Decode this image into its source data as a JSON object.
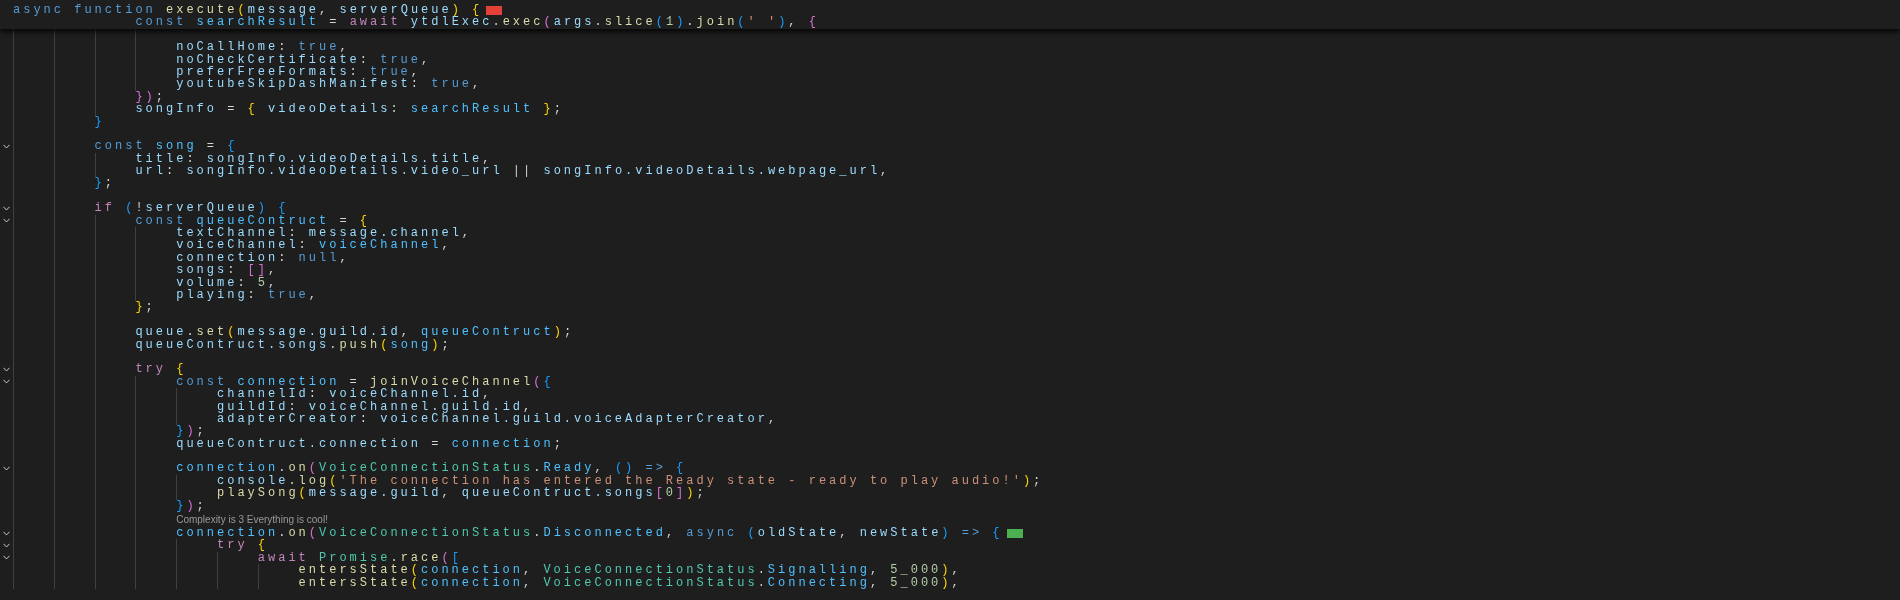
{
  "sticky": [
    {
      "color": "#e5403a",
      "tokens": [
        {
          "kind": "keyword",
          "text": "async function "
        },
        {
          "kind": "function",
          "text": "execute"
        },
        {
          "kind": "bracket1",
          "text": "("
        },
        {
          "kind": "variable",
          "text": "message"
        },
        {
          "kind": "plain",
          "text": ", "
        },
        {
          "kind": "variable",
          "text": "serverQueue"
        },
        {
          "kind": "bracket1",
          "text": ") "
        },
        {
          "kind": "bracket1",
          "text": "{"
        }
      ]
    },
    {
      "tokens": [
        {
          "kind": "keyword",
          "text": "            const "
        },
        {
          "kind": "constant",
          "text": "searchResult"
        },
        {
          "kind": "plain",
          "text": " = "
        },
        {
          "kind": "control",
          "text": "await "
        },
        {
          "kind": "variable",
          "text": "ytdlExec"
        },
        {
          "kind": "plain",
          "text": "."
        },
        {
          "kind": "function",
          "text": "exec"
        },
        {
          "kind": "bracket2",
          "text": "("
        },
        {
          "kind": "variable",
          "text": "args"
        },
        {
          "kind": "plain",
          "text": "."
        },
        {
          "kind": "function",
          "text": "slice"
        },
        {
          "kind": "bracket3",
          "text": "("
        },
        {
          "kind": "number",
          "text": "1"
        },
        {
          "kind": "bracket3",
          "text": ")"
        },
        {
          "kind": "plain",
          "text": "."
        },
        {
          "kind": "function",
          "text": "join"
        },
        {
          "kind": "bracket3",
          "text": "("
        },
        {
          "kind": "string",
          "text": "' '"
        },
        {
          "kind": "bracket3",
          "text": ")"
        },
        {
          "kind": "plain",
          "text": ", "
        },
        {
          "kind": "bracket2",
          "text": "{"
        }
      ]
    }
  ],
  "lines": [
    {
      "kind": "blank",
      "fold": false
    },
    {
      "kind": "code",
      "fold": false,
      "tokens": [
        {
          "kind": "variable",
          "text": "                noCallHome"
        },
        {
          "kind": "plain",
          "text": ": "
        },
        {
          "kind": "keyword",
          "text": "true"
        },
        {
          "kind": "plain",
          "text": ","
        }
      ]
    },
    {
      "kind": "code",
      "fold": false,
      "tokens": [
        {
          "kind": "variable",
          "text": "                noCheckCertificate"
        },
        {
          "kind": "plain",
          "text": ": "
        },
        {
          "kind": "keyword",
          "text": "true"
        },
        {
          "kind": "plain",
          "text": ","
        }
      ]
    },
    {
      "kind": "code",
      "fold": false,
      "tokens": [
        {
          "kind": "variable",
          "text": "                preferFreeFormats"
        },
        {
          "kind": "plain",
          "text": ": "
        },
        {
          "kind": "keyword",
          "text": "true"
        },
        {
          "kind": "plain",
          "text": ","
        }
      ]
    },
    {
      "kind": "code",
      "fold": false,
      "tokens": [
        {
          "kind": "variable",
          "text": "                youtubeSkipDashManifest"
        },
        {
          "kind": "plain",
          "text": ": "
        },
        {
          "kind": "keyword",
          "text": "true"
        },
        {
          "kind": "plain",
          "text": ","
        }
      ]
    },
    {
      "kind": "code",
      "fold": false,
      "tokens": [
        {
          "kind": "bracket2",
          "text": "            })"
        },
        {
          "kind": "plain",
          "text": ";"
        }
      ]
    },
    {
      "kind": "code",
      "fold": false,
      "tokens": [
        {
          "kind": "variable",
          "text": "            songInfo"
        },
        {
          "kind": "plain",
          "text": " = "
        },
        {
          "kind": "bracket1",
          "text": "{ "
        },
        {
          "kind": "variable",
          "text": "videoDetails"
        },
        {
          "kind": "plain",
          "text": ": "
        },
        {
          "kind": "constant",
          "text": "searchResult "
        },
        {
          "kind": "bracket1",
          "text": "}"
        },
        {
          "kind": "plain",
          "text": ";"
        }
      ]
    },
    {
      "kind": "code",
      "fold": false,
      "tokens": [
        {
          "kind": "bracket3",
          "text": "        }"
        }
      ]
    },
    {
      "kind": "blank",
      "fold": false
    },
    {
      "kind": "code",
      "fold": true,
      "tokens": [
        {
          "kind": "keyword",
          "text": "        const "
        },
        {
          "kind": "constant",
          "text": "song"
        },
        {
          "kind": "plain",
          "text": " = "
        },
        {
          "kind": "bracket3",
          "text": "{"
        }
      ]
    },
    {
      "kind": "code",
      "fold": false,
      "tokens": [
        {
          "kind": "variable",
          "text": "            title"
        },
        {
          "kind": "plain",
          "text": ": "
        },
        {
          "kind": "variable",
          "text": "songInfo.videoDetails.title"
        },
        {
          "kind": "plain",
          "text": ","
        }
      ]
    },
    {
      "kind": "code",
      "fold": false,
      "tokens": [
        {
          "kind": "variable",
          "text": "            url"
        },
        {
          "kind": "plain",
          "text": ": "
        },
        {
          "kind": "variable",
          "text": "songInfo.videoDetails.video_url"
        },
        {
          "kind": "plain",
          "text": " || "
        },
        {
          "kind": "variable",
          "text": "songInfo.videoDetails.webpage_url"
        },
        {
          "kind": "plain",
          "text": ","
        }
      ]
    },
    {
      "kind": "code",
      "fold": false,
      "tokens": [
        {
          "kind": "bracket3",
          "text": "        }"
        },
        {
          "kind": "plain",
          "text": ";"
        }
      ]
    },
    {
      "kind": "blank",
      "fold": false
    },
    {
      "kind": "code",
      "fold": true,
      "tokens": [
        {
          "kind": "control",
          "text": "        if "
        },
        {
          "kind": "bracket3",
          "text": "("
        },
        {
          "kind": "plain",
          "text": "!"
        },
        {
          "kind": "variable",
          "text": "serverQueue"
        },
        {
          "kind": "bracket3",
          "text": ") "
        },
        {
          "kind": "bracket3",
          "text": "{"
        }
      ]
    },
    {
      "kind": "code",
      "fold": true,
      "tokens": [
        {
          "kind": "keyword",
          "text": "            const "
        },
        {
          "kind": "constant",
          "text": "queueContruct"
        },
        {
          "kind": "plain",
          "text": " = "
        },
        {
          "kind": "bracket1",
          "text": "{"
        }
      ]
    },
    {
      "kind": "code",
      "fold": false,
      "tokens": [
        {
          "kind": "variable",
          "text": "                textChannel"
        },
        {
          "kind": "plain",
          "text": ": "
        },
        {
          "kind": "variable",
          "text": "message.channel"
        },
        {
          "kind": "plain",
          "text": ","
        }
      ]
    },
    {
      "kind": "code",
      "fold": false,
      "tokens": [
        {
          "kind": "variable",
          "text": "                voiceChannel"
        },
        {
          "kind": "plain",
          "text": ": "
        },
        {
          "kind": "constant",
          "text": "voiceChannel"
        },
        {
          "kind": "plain",
          "text": ","
        }
      ]
    },
    {
      "kind": "code",
      "fold": false,
      "tokens": [
        {
          "kind": "variable",
          "text": "                connection"
        },
        {
          "kind": "plain",
          "text": ": "
        },
        {
          "kind": "keyword",
          "text": "null"
        },
        {
          "kind": "plain",
          "text": ","
        }
      ]
    },
    {
      "kind": "code",
      "fold": false,
      "tokens": [
        {
          "kind": "variable",
          "text": "                songs"
        },
        {
          "kind": "plain",
          "text": ": "
        },
        {
          "kind": "bracket2",
          "text": "[]"
        },
        {
          "kind": "plain",
          "text": ","
        }
      ]
    },
    {
      "kind": "code",
      "fold": false,
      "tokens": [
        {
          "kind": "variable",
          "text": "                volume"
        },
        {
          "kind": "plain",
          "text": ": "
        },
        {
          "kind": "number",
          "text": "5"
        },
        {
          "kind": "plain",
          "text": ","
        }
      ]
    },
    {
      "kind": "code",
      "fold": false,
      "tokens": [
        {
          "kind": "variable",
          "text": "                playing"
        },
        {
          "kind": "plain",
          "text": ": "
        },
        {
          "kind": "keyword",
          "text": "true"
        },
        {
          "kind": "plain",
          "text": ","
        }
      ]
    },
    {
      "kind": "code",
      "fold": false,
      "tokens": [
        {
          "kind": "bracket1",
          "text": "            }"
        },
        {
          "kind": "plain",
          "text": ";"
        }
      ]
    },
    {
      "kind": "blank",
      "fold": false
    },
    {
      "kind": "code",
      "fold": false,
      "tokens": [
        {
          "kind": "variable",
          "text": "            queue"
        },
        {
          "kind": "plain",
          "text": "."
        },
        {
          "kind": "function",
          "text": "set"
        },
        {
          "kind": "bracket1",
          "text": "("
        },
        {
          "kind": "variable",
          "text": "message.guild.id"
        },
        {
          "kind": "plain",
          "text": ", "
        },
        {
          "kind": "constant",
          "text": "queueContruct"
        },
        {
          "kind": "bracket1",
          "text": ")"
        },
        {
          "kind": "plain",
          "text": ";"
        }
      ]
    },
    {
      "kind": "code",
      "fold": false,
      "tokens": [
        {
          "kind": "variable",
          "text": "            queueContruct.songs"
        },
        {
          "kind": "plain",
          "text": "."
        },
        {
          "kind": "function",
          "text": "push"
        },
        {
          "kind": "bracket1",
          "text": "("
        },
        {
          "kind": "constant",
          "text": "song"
        },
        {
          "kind": "bracket1",
          "text": ")"
        },
        {
          "kind": "plain",
          "text": ";"
        }
      ]
    },
    {
      "kind": "blank",
      "fold": false
    },
    {
      "kind": "code",
      "fold": true,
      "tokens": [
        {
          "kind": "control",
          "text": "            try "
        },
        {
          "kind": "bracket1",
          "text": "{"
        }
      ]
    },
    {
      "kind": "code",
      "fold": true,
      "tokens": [
        {
          "kind": "keyword",
          "text": "                const "
        },
        {
          "kind": "constant",
          "text": "connection"
        },
        {
          "kind": "plain",
          "text": " = "
        },
        {
          "kind": "function",
          "text": "joinVoiceChannel"
        },
        {
          "kind": "bracket2",
          "text": "("
        },
        {
          "kind": "bracket3",
          "text": "{"
        }
      ]
    },
    {
      "kind": "code",
      "fold": false,
      "tokens": [
        {
          "kind": "variable",
          "text": "                    channelId"
        },
        {
          "kind": "plain",
          "text": ": "
        },
        {
          "kind": "variable",
          "text": "voiceChannel.id"
        },
        {
          "kind": "plain",
          "text": ","
        }
      ]
    },
    {
      "kind": "code",
      "fold": false,
      "tokens": [
        {
          "kind": "variable",
          "text": "                    guildId"
        },
        {
          "kind": "plain",
          "text": ": "
        },
        {
          "kind": "variable",
          "text": "voiceChannel.guild.id"
        },
        {
          "kind": "plain",
          "text": ","
        }
      ]
    },
    {
      "kind": "code",
      "fold": false,
      "tokens": [
        {
          "kind": "variable",
          "text": "                    adapterCreator"
        },
        {
          "kind": "plain",
          "text": ": "
        },
        {
          "kind": "variable",
          "text": "voiceChannel.guild.voiceAdapterCreator"
        },
        {
          "kind": "plain",
          "text": ","
        }
      ]
    },
    {
      "kind": "code",
      "fold": false,
      "tokens": [
        {
          "kind": "bracket3",
          "text": "                }"
        },
        {
          "kind": "bracket2",
          "text": ")"
        },
        {
          "kind": "plain",
          "text": ";"
        }
      ]
    },
    {
      "kind": "code",
      "fold": false,
      "tokens": [
        {
          "kind": "variable",
          "text": "                queueContruct.connection"
        },
        {
          "kind": "plain",
          "text": " = "
        },
        {
          "kind": "constant",
          "text": "connection"
        },
        {
          "kind": "plain",
          "text": ";"
        }
      ]
    },
    {
      "kind": "blank",
      "fold": false
    },
    {
      "kind": "code",
      "fold": true,
      "tokens": [
        {
          "kind": "constant",
          "text": "                connection"
        },
        {
          "kind": "plain",
          "text": "."
        },
        {
          "kind": "function",
          "text": "on"
        },
        {
          "kind": "bracket2",
          "text": "("
        },
        {
          "kind": "type",
          "text": "VoiceConnectionStatus"
        },
        {
          "kind": "plain",
          "text": "."
        },
        {
          "kind": "constant",
          "text": "Ready"
        },
        {
          "kind": "plain",
          "text": ", "
        },
        {
          "kind": "bracket3",
          "text": "() "
        },
        {
          "kind": "keyword",
          "text": "=> "
        },
        {
          "kind": "bracket3",
          "text": "{"
        }
      ]
    },
    {
      "kind": "code",
      "fold": false,
      "tokens": [
        {
          "kind": "variable",
          "text": "                    console"
        },
        {
          "kind": "plain",
          "text": "."
        },
        {
          "kind": "function",
          "text": "log"
        },
        {
          "kind": "bracket1",
          "text": "("
        },
        {
          "kind": "string",
          "text": "'The connection has entered the Ready state - ready to play audio!'"
        },
        {
          "kind": "bracket1",
          "text": ")"
        },
        {
          "kind": "plain",
          "text": ";"
        }
      ]
    },
    {
      "kind": "code",
      "fold": false,
      "tokens": [
        {
          "kind": "function",
          "text": "                    playSong"
        },
        {
          "kind": "bracket1",
          "text": "("
        },
        {
          "kind": "variable",
          "text": "message.guild"
        },
        {
          "kind": "plain",
          "text": ", "
        },
        {
          "kind": "variable",
          "text": "queueContruct.songs"
        },
        {
          "kind": "bracket2",
          "text": "["
        },
        {
          "kind": "number",
          "text": "0"
        },
        {
          "kind": "bracket2",
          "text": "]"
        },
        {
          "kind": "bracket1",
          "text": ")"
        },
        {
          "kind": "plain",
          "text": ";"
        }
      ]
    },
    {
      "kind": "code",
      "fold": false,
      "tokens": [
        {
          "kind": "bracket3",
          "text": "                }"
        },
        {
          "kind": "bracket2",
          "text": ")"
        },
        {
          "kind": "plain",
          "text": ";"
        }
      ]
    },
    {
      "kind": "codelens",
      "fold": false,
      "text": "Complexity is 3 Everything is cool!"
    },
    {
      "kind": "code",
      "fold": true,
      "color": "#4caf50",
      "tokens": [
        {
          "kind": "constant",
          "text": "                connection"
        },
        {
          "kind": "plain",
          "text": "."
        },
        {
          "kind": "function",
          "text": "on"
        },
        {
          "kind": "bracket2",
          "text": "("
        },
        {
          "kind": "type",
          "text": "VoiceConnectionStatus"
        },
        {
          "kind": "plain",
          "text": "."
        },
        {
          "kind": "constant",
          "text": "Disconnected"
        },
        {
          "kind": "plain",
          "text": ", "
        },
        {
          "kind": "keyword",
          "text": "async "
        },
        {
          "kind": "bracket3",
          "text": "("
        },
        {
          "kind": "variable",
          "text": "oldState"
        },
        {
          "kind": "plain",
          "text": ", "
        },
        {
          "kind": "variable",
          "text": "newState"
        },
        {
          "kind": "bracket3",
          "text": ") "
        },
        {
          "kind": "keyword",
          "text": "=> "
        },
        {
          "kind": "bracket3",
          "text": "{"
        }
      ]
    },
    {
      "kind": "code",
      "fold": true,
      "tokens": [
        {
          "kind": "control",
          "text": "                    try "
        },
        {
          "kind": "bracket1",
          "text": "{"
        }
      ]
    },
    {
      "kind": "code",
      "fold": true,
      "tokens": [
        {
          "kind": "control",
          "text": "                        await "
        },
        {
          "kind": "type",
          "text": "Promise"
        },
        {
          "kind": "plain",
          "text": "."
        },
        {
          "kind": "function",
          "text": "race"
        },
        {
          "kind": "bracket2",
          "text": "("
        },
        {
          "kind": "bracket3",
          "text": "["
        }
      ]
    },
    {
      "kind": "code",
      "fold": false,
      "tokens": [
        {
          "kind": "function",
          "text": "                            entersState"
        },
        {
          "kind": "bracket1",
          "text": "("
        },
        {
          "kind": "constant",
          "text": "connection"
        },
        {
          "kind": "plain",
          "text": ", "
        },
        {
          "kind": "type",
          "text": "VoiceConnectionStatus"
        },
        {
          "kind": "plain",
          "text": "."
        },
        {
          "kind": "constant",
          "text": "Signalling"
        },
        {
          "kind": "plain",
          "text": ", "
        },
        {
          "kind": "number",
          "text": "5_000"
        },
        {
          "kind": "bracket1",
          "text": ")"
        },
        {
          "kind": "plain",
          "text": ","
        }
      ]
    },
    {
      "kind": "code",
      "fold": false,
      "tokens": [
        {
          "kind": "function",
          "text": "                            entersState"
        },
        {
          "kind": "bracket1",
          "text": "("
        },
        {
          "kind": "constant",
          "text": "connection"
        },
        {
          "kind": "plain",
          "text": ", "
        },
        {
          "kind": "type",
          "text": "VoiceConnectionStatus"
        },
        {
          "kind": "plain",
          "text": "."
        },
        {
          "kind": "constant",
          "text": "Connecting"
        },
        {
          "kind": "plain",
          "text": ", "
        },
        {
          "kind": "number",
          "text": "5_000"
        },
        {
          "kind": "bracket1",
          "text": ")"
        },
        {
          "kind": "plain",
          "text": ","
        }
      ]
    }
  ]
}
